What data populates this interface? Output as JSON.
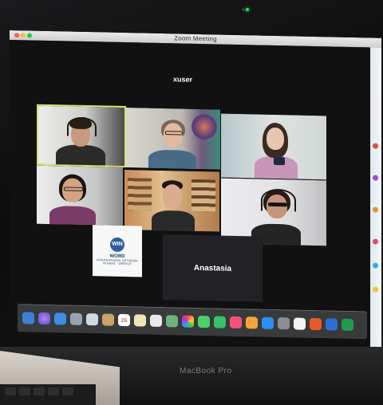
{
  "window": {
    "title": "Zoom Meeting"
  },
  "meeting": {
    "active_speaker": "xuser",
    "name_tile": "Anastasia",
    "logo": {
      "badge": "WIN",
      "line1": "WORD",
      "line2": "INTERNATIONAL NETWORK",
      "line3": "ATHENS · GREECE"
    }
  },
  "laptop": {
    "brand": "MacBook Pro"
  },
  "dock": {
    "calendar_day": "26"
  },
  "colors": {
    "active_speaker_border": "#d7e36a",
    "zoom_bg": "#111111",
    "titlebar": "#dcdcde"
  }
}
